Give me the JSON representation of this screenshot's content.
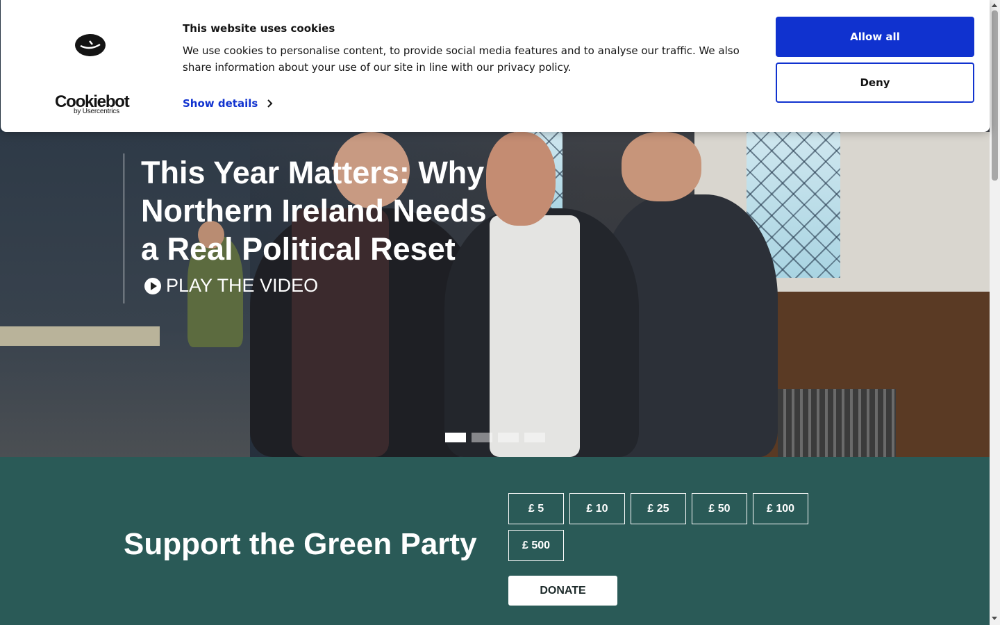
{
  "cookie_banner": {
    "title": "This website uses cookies",
    "text": "We use cookies to personalise content, to provide social media features and to analyse our traffic. We also share information about your use of our site in line with our privacy policy.",
    "show_details": "Show details",
    "allow_all": "Allow all",
    "deny": "Deny",
    "brand": "Cookiebot",
    "brand_sub": "by Usercentrics",
    "colors": {
      "primary": "#1032cf",
      "text": "#141414"
    }
  },
  "hero": {
    "title": "This Year Matters: Why Northern Ireland Needs a Real Political Reset",
    "play_label": "PLAY THE VIDEO",
    "slides": {
      "count": 4,
      "active": 1
    }
  },
  "support": {
    "title": "Support the Green Party",
    "amounts": [
      "£ 5",
      "£ 10",
      "£ 25",
      "£ 50",
      "£ 100",
      "£ 500"
    ],
    "donate_label": "DONATE",
    "colors": {
      "background": "#2a5a57"
    }
  }
}
